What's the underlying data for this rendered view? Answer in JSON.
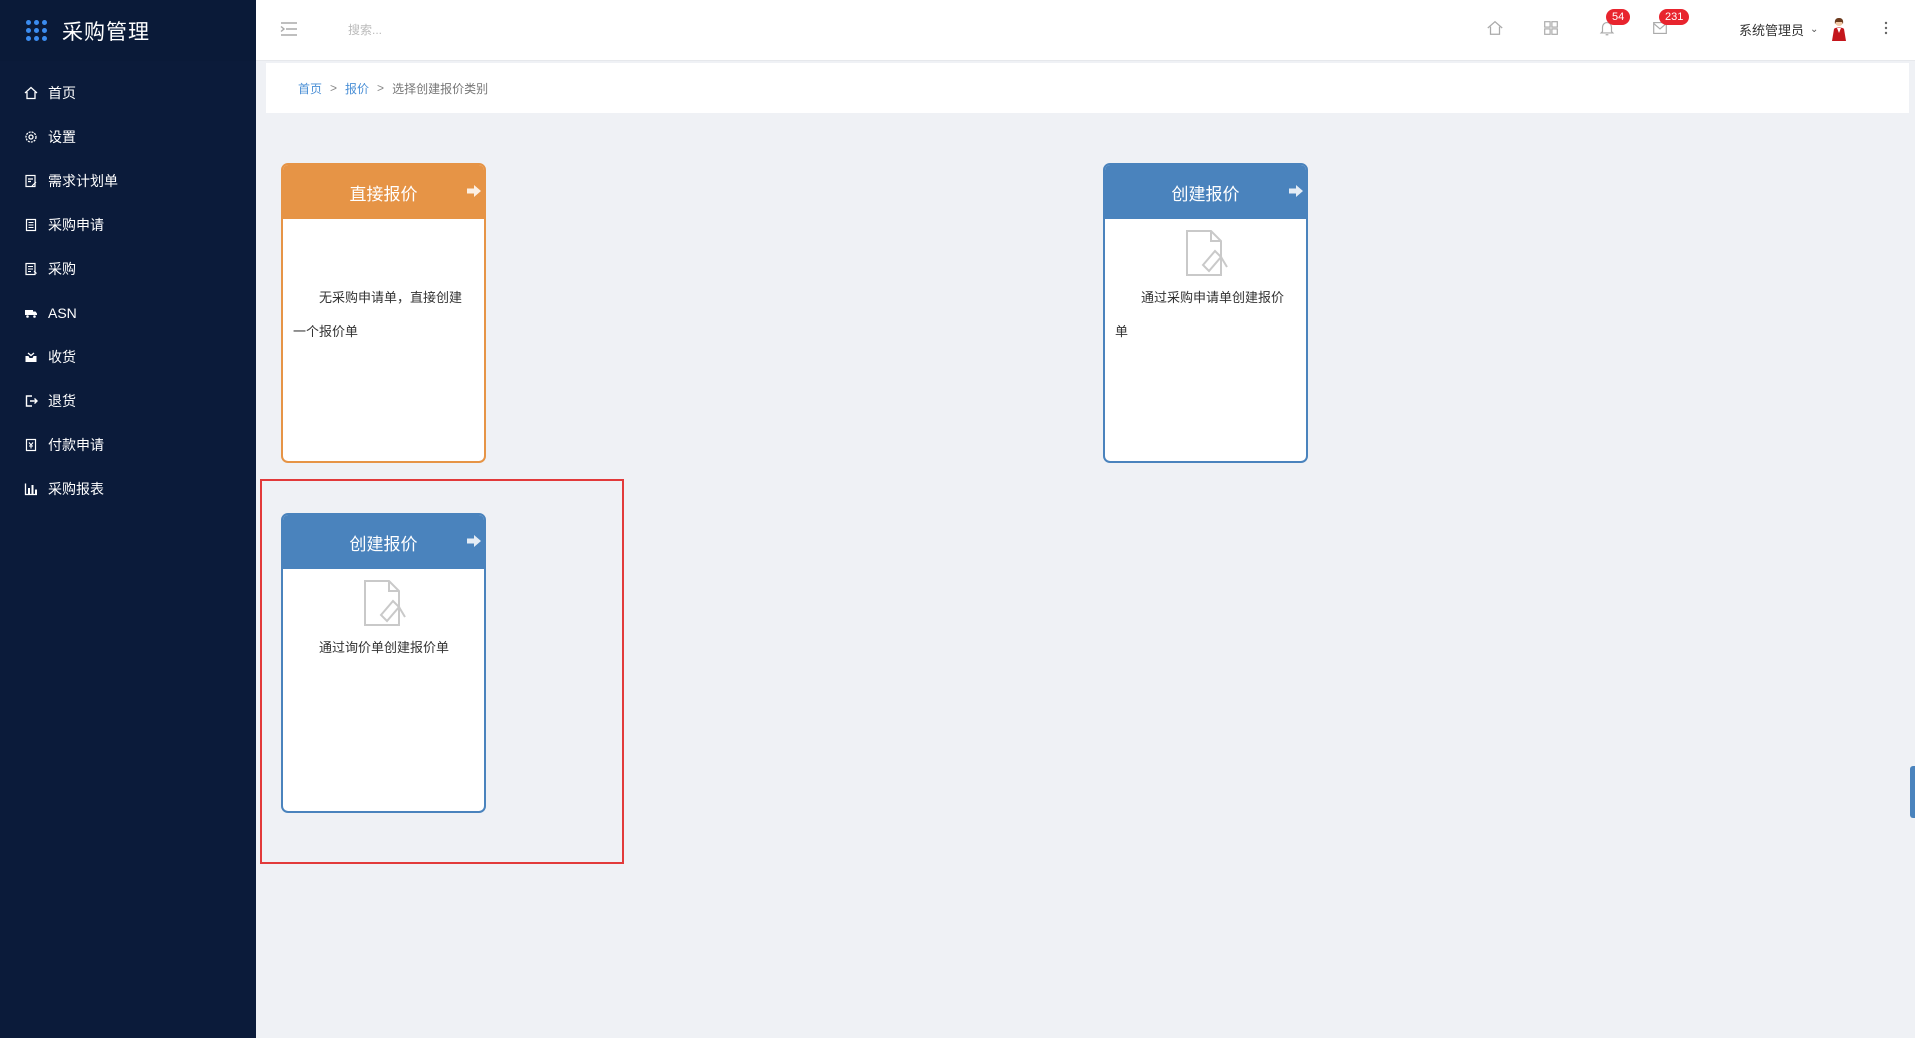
{
  "app": {
    "title": "采购管理"
  },
  "sidebar": {
    "items": [
      {
        "label": "首页",
        "icon": "home-icon"
      },
      {
        "label": "设置",
        "icon": "gear-icon"
      },
      {
        "label": "需求计划单",
        "icon": "document-edit-icon"
      },
      {
        "label": "采购申请",
        "icon": "clipboard-icon"
      },
      {
        "label": "采购",
        "icon": "list-document-icon"
      },
      {
        "label": "ASN",
        "icon": "truck-icon"
      },
      {
        "label": "收货",
        "icon": "inbox-icon"
      },
      {
        "label": "退货",
        "icon": "return-icon"
      },
      {
        "label": "付款申请",
        "icon": "payment-doc-icon"
      },
      {
        "label": "采购报表",
        "icon": "bar-chart-icon"
      }
    ]
  },
  "header": {
    "search_placeholder": "搜索...",
    "notifications_count": "54",
    "messages_count": "231",
    "user_name": "系统管理员"
  },
  "breadcrumb": {
    "home": "首页",
    "section": "报价",
    "current": "选择创建报价类别",
    "separator": ">"
  },
  "cards": [
    {
      "title": "直接报价",
      "description": "无采购申请单，直接创建一个报价单",
      "color": "#e69446"
    },
    {
      "title": "创建报价",
      "description": "通过采购申请单创建报价单",
      "color": "#4a83bd"
    },
    {
      "title": "创建报价",
      "description": "通过询价单创建报价单",
      "color": "#4a83bd"
    }
  ],
  "colors": {
    "sidebar_bg": "#0b1b3a",
    "accent_blue": "#4a83bd",
    "accent_orange": "#e69446",
    "highlight_red": "#e23a3a",
    "badge_red": "#e8242e"
  }
}
